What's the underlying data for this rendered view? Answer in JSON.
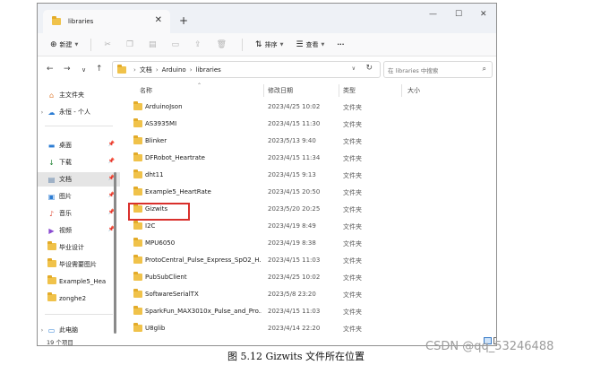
{
  "window": {
    "tab_title": "libraries",
    "new_tab": "+",
    "minimize": "—",
    "maximize": "☐",
    "close": "✕"
  },
  "toolbar": {
    "new_label": "新建",
    "sort_label": "排序",
    "view_label": "查看",
    "more_label": "···"
  },
  "nav": {
    "back": "←",
    "forward": "→",
    "recent": "∨",
    "up": "↑",
    "breadcrumb": [
      "文档",
      "Arduino",
      "libraries"
    ],
    "breadcrumb_sep": "›",
    "dropdown": "∨",
    "refresh": "↻",
    "search_placeholder": "在 libraries 中搜索"
  },
  "sidebar": {
    "items": [
      {
        "label": "主文件夹",
        "icon": "home-icon"
      },
      {
        "label": "永恒 - 个人",
        "icon": "onedrive-icon"
      },
      {
        "label": "桌面",
        "icon": "desktop-icon"
      },
      {
        "label": "下载",
        "icon": "download-icon"
      },
      {
        "label": "文档",
        "icon": "documents-icon"
      },
      {
        "label": "图片",
        "icon": "pictures-icon"
      },
      {
        "label": "音乐",
        "icon": "music-icon"
      },
      {
        "label": "视频",
        "icon": "videos-icon"
      },
      {
        "label": "毕业设计",
        "icon": "folder-icon"
      },
      {
        "label": "毕设需要图片",
        "icon": "folder-icon"
      },
      {
        "label": "Example5_Hea",
        "icon": "folder-icon"
      },
      {
        "label": "zonghe2",
        "icon": "folder-icon"
      },
      {
        "label": "此电脑",
        "icon": "pc-icon"
      }
    ]
  },
  "columns": {
    "name": "名称",
    "date": "修改日期",
    "type": "类型",
    "size": "大小"
  },
  "files": [
    {
      "name": "ArduinoJson",
      "date": "2023/4/25 10:02",
      "type": "文件夹"
    },
    {
      "name": "AS3935MI",
      "date": "2023/4/15 11:30",
      "type": "文件夹"
    },
    {
      "name": "Blinker",
      "date": "2023/5/13 9:40",
      "type": "文件夹"
    },
    {
      "name": "DFRobot_Heartrate",
      "date": "2023/4/15 11:34",
      "type": "文件夹"
    },
    {
      "name": "dht11",
      "date": "2023/4/15 9:13",
      "type": "文件夹"
    },
    {
      "name": "Example5_HeartRate",
      "date": "2023/4/15 20:50",
      "type": "文件夹"
    },
    {
      "name": "Gizwits",
      "date": "2023/5/20 20:25",
      "type": "文件夹"
    },
    {
      "name": "I2C",
      "date": "2023/4/19 8:49",
      "type": "文件夹"
    },
    {
      "name": "MPU6050",
      "date": "2023/4/19 8:38",
      "type": "文件夹"
    },
    {
      "name": "ProtoCentral_Pulse_Express_SpO2_H...",
      "date": "2023/4/15 11:03",
      "type": "文件夹"
    },
    {
      "name": "PubSubClient",
      "date": "2023/4/25 10:02",
      "type": "文件夹"
    },
    {
      "name": "SoftwareSerialTX",
      "date": "2023/5/8 23:20",
      "type": "文件夹"
    },
    {
      "name": "SparkFun_MAX3010x_Pulse_and_Pro...",
      "date": "2023/4/15 11:03",
      "type": "文件夹"
    },
    {
      "name": "U8glib",
      "date": "2023/4/14 22:20",
      "type": "文件夹"
    }
  ],
  "status": {
    "count": "19 个项目"
  },
  "caption": "图 5.12 Gizwits 文件所在位置",
  "watermark": "CSDN @qq_53246488",
  "colors": {
    "highlight": "#d9302c",
    "folder": "#f0c24a"
  }
}
